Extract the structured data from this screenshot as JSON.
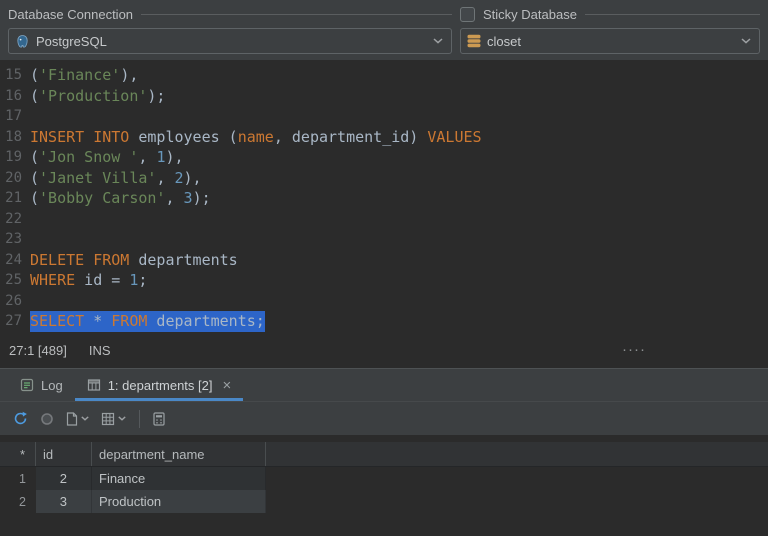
{
  "colors": {
    "panel_bg": "#3c3f41",
    "editor_bg": "#2b2b2b",
    "keyword": "#cc7832",
    "string": "#6a8759",
    "number": "#6897bb",
    "plain": "#a9b7c6",
    "selection_bg": "#2d65c8",
    "tab_underline": "#4a88c7"
  },
  "connection_panel": {
    "database_connection_label": "Database Connection",
    "sticky_database_label": "Sticky Database",
    "sticky_checked": false,
    "connection_value": "PostgreSQL",
    "database_value": "closet"
  },
  "editor": {
    "lines": [
      {
        "num": "15",
        "segments": [
          {
            "t": "(",
            "c": "plain"
          },
          {
            "t": "'Finance'",
            "c": "string"
          },
          {
            "t": "),",
            "c": "plain"
          }
        ]
      },
      {
        "num": "16",
        "segments": [
          {
            "t": "(",
            "c": "plain"
          },
          {
            "t": "'Production'",
            "c": "string"
          },
          {
            "t": ");",
            "c": "plain"
          }
        ]
      },
      {
        "num": "17",
        "segments": []
      },
      {
        "num": "18",
        "segments": [
          {
            "t": "INSERT INTO",
            "c": "keyword"
          },
          {
            "t": " employees (",
            "c": "plain"
          },
          {
            "t": "name",
            "c": "keyword"
          },
          {
            "t": ", department_id) ",
            "c": "plain"
          },
          {
            "t": "VALUES",
            "c": "keyword"
          }
        ]
      },
      {
        "num": "19",
        "segments": [
          {
            "t": "(",
            "c": "plain"
          },
          {
            "t": "'Jon Snow '",
            "c": "string"
          },
          {
            "t": ", ",
            "c": "plain"
          },
          {
            "t": "1",
            "c": "number"
          },
          {
            "t": "),",
            "c": "plain"
          }
        ]
      },
      {
        "num": "20",
        "segments": [
          {
            "t": "(",
            "c": "plain"
          },
          {
            "t": "'Janet Villa'",
            "c": "string"
          },
          {
            "t": ", ",
            "c": "plain"
          },
          {
            "t": "2",
            "c": "number"
          },
          {
            "t": "),",
            "c": "plain"
          }
        ]
      },
      {
        "num": "21",
        "segments": [
          {
            "t": "(",
            "c": "plain"
          },
          {
            "t": "'Bobby Carson'",
            "c": "string"
          },
          {
            "t": ", ",
            "c": "plain"
          },
          {
            "t": "3",
            "c": "number"
          },
          {
            "t": ");",
            "c": "plain"
          }
        ]
      },
      {
        "num": "22",
        "segments": []
      },
      {
        "num": "23",
        "segments": []
      },
      {
        "num": "24",
        "segments": [
          {
            "t": "DELETE FROM",
            "c": "keyword"
          },
          {
            "t": " departments",
            "c": "plain"
          }
        ]
      },
      {
        "num": "25",
        "segments": [
          {
            "t": "WHERE",
            "c": "keyword"
          },
          {
            "t": " id = ",
            "c": "plain"
          },
          {
            "t": "1",
            "c": "number"
          },
          {
            "t": ";",
            "c": "plain"
          }
        ]
      },
      {
        "num": "26",
        "segments": []
      },
      {
        "num": "27",
        "selected": true,
        "segments": [
          {
            "t": "SELECT",
            "c": "keyword"
          },
          {
            "t": " * ",
            "c": "plain"
          },
          {
            "t": "FROM",
            "c": "keyword"
          },
          {
            "t": " departments;",
            "c": "plain"
          }
        ]
      }
    ]
  },
  "status_bar": {
    "caret": "27:1 [489]",
    "mode": "INS",
    "splitter_dots": "····"
  },
  "tabs": [
    {
      "label": "Log",
      "active": false
    },
    {
      "label": "1: departments [2]",
      "active": true,
      "close_glyph": "×"
    }
  ],
  "toolbar": {
    "icons": [
      "refresh-icon",
      "stop-circle-icon",
      "document-icon",
      "grid-icon",
      "calculator-icon"
    ]
  },
  "results": {
    "gutter_header": "*",
    "columns": [
      "id",
      "department_name"
    ],
    "rows": [
      {
        "row_number": "1",
        "id": "2",
        "department_name": "Finance"
      },
      {
        "row_number": "2",
        "id": "3",
        "department_name": "Production"
      }
    ]
  }
}
